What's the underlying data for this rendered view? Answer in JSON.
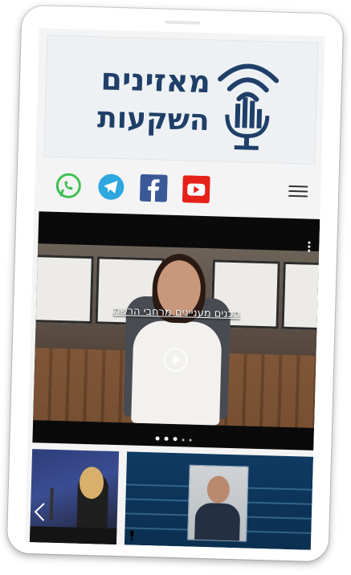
{
  "logo": {
    "line1": "מאזינים",
    "line2": "השקעות",
    "icon": "podcast-microphone-icon"
  },
  "nav": {
    "social": [
      {
        "name": "whatsapp",
        "icon": "whatsapp-icon",
        "color": "#3fbf52"
      },
      {
        "name": "telegram",
        "icon": "telegram-icon",
        "color": "#2ea6e0"
      },
      {
        "name": "facebook",
        "icon": "facebook-icon",
        "color": "#3b5998"
      },
      {
        "name": "youtube",
        "icon": "youtube-icon",
        "color": "#e62117"
      }
    ],
    "menu_icon": "hamburger-menu-icon"
  },
  "video": {
    "caption": "תכנים מעניינים מרחבי הרשת",
    "play_icon": "play-icon",
    "more_icon": "more-vertical-icon"
  },
  "colors": {
    "brand": "#1f3f68",
    "video_bg": "#0a0a0a",
    "thumb_bg": "#0f3a62"
  }
}
